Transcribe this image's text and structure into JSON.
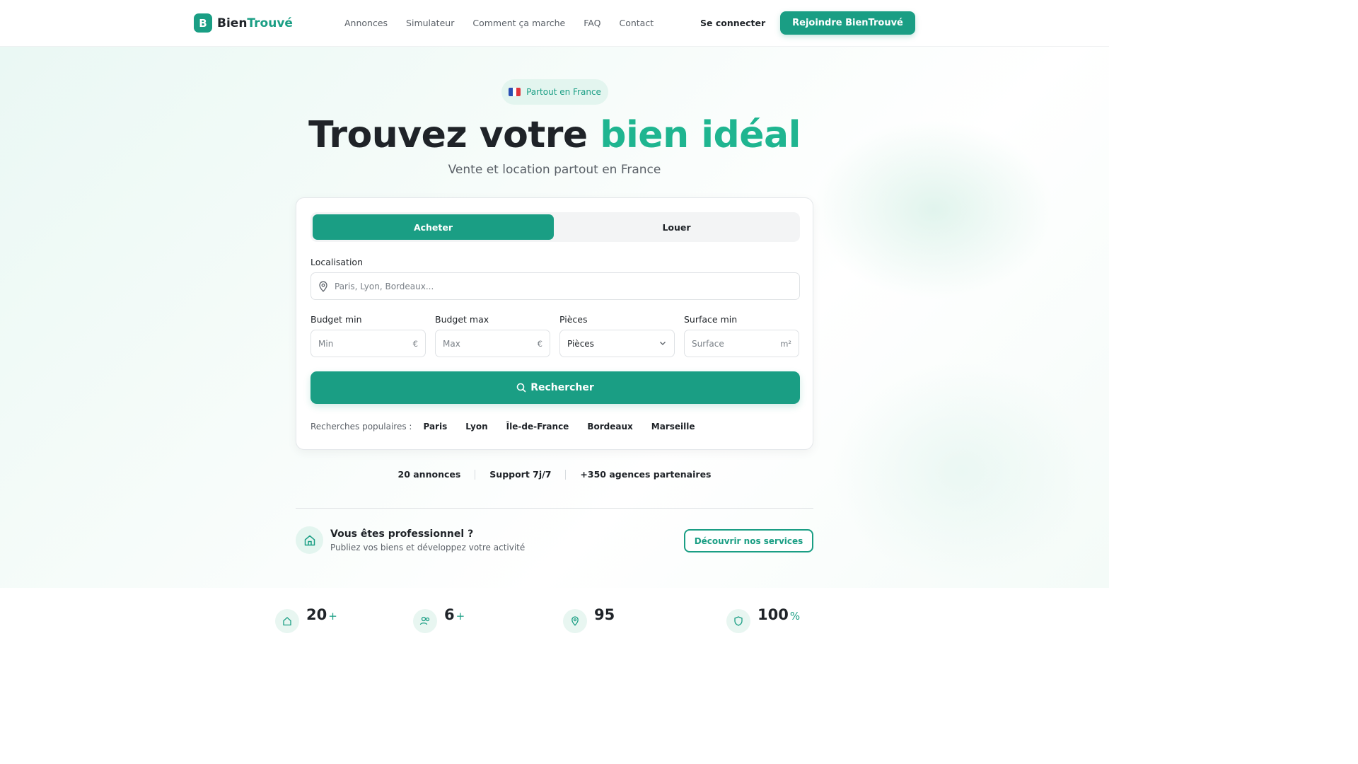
{
  "brand": {
    "mark": "B",
    "name_part1": "Bien",
    "name_part2": "Trouvé"
  },
  "nav": {
    "links": [
      "Annonces",
      "Simulateur",
      "Comment ça marche",
      "FAQ",
      "Contact"
    ],
    "login_label": "Se connecter",
    "cta_label": "Rejoindre BienTrouvé"
  },
  "hero": {
    "badge": "Partout en France",
    "title_part1": "Trouvez votre ",
    "title_part2": "bien idéal",
    "subtitle": "Vente et location partout en France"
  },
  "search": {
    "tabs": [
      "Acheter",
      "Louer"
    ],
    "active_tab": "Acheter",
    "location_label": "Localisation",
    "location_placeholder": "Paris, Lyon, Bordeaux...",
    "budget_min_label": "Budget min",
    "budget_min_placeholder": "Min",
    "budget_max_label": "Budget max",
    "budget_max_placeholder": "Max",
    "currency_unit": "€",
    "rooms_label": "Pièces",
    "rooms_value": "Pièces",
    "surface_label": "Surface min",
    "surface_placeholder": "Surface",
    "surface_unit": "m²",
    "button_label": "Rechercher",
    "popular_label": "Recherches populaires :",
    "popular": [
      "Paris",
      "Lyon",
      "Île-de-France",
      "Bordeaux",
      "Marseille"
    ]
  },
  "trust": [
    "20 annonces",
    "Support 7j/7",
    "+350 agences partenaires"
  ],
  "pro": {
    "title": "Vous êtes professionnel ?",
    "subtitle": "Publiez vos biens et développez votre activité",
    "button_label": "Découvrir nos services"
  },
  "stats": [
    {
      "value": "20",
      "suffix": "+",
      "icon": "home-icon"
    },
    {
      "value": "6",
      "suffix": "+",
      "icon": "users-icon"
    },
    {
      "value": "95",
      "suffix": "",
      "icon": "map-pin-icon"
    },
    {
      "value": "100",
      "suffix": "%",
      "icon": "shield-icon"
    }
  ],
  "colors": {
    "accent": "#1a9e84",
    "accent_light": "#1fb590",
    "text": "#1f2328",
    "muted": "#5b6168"
  }
}
